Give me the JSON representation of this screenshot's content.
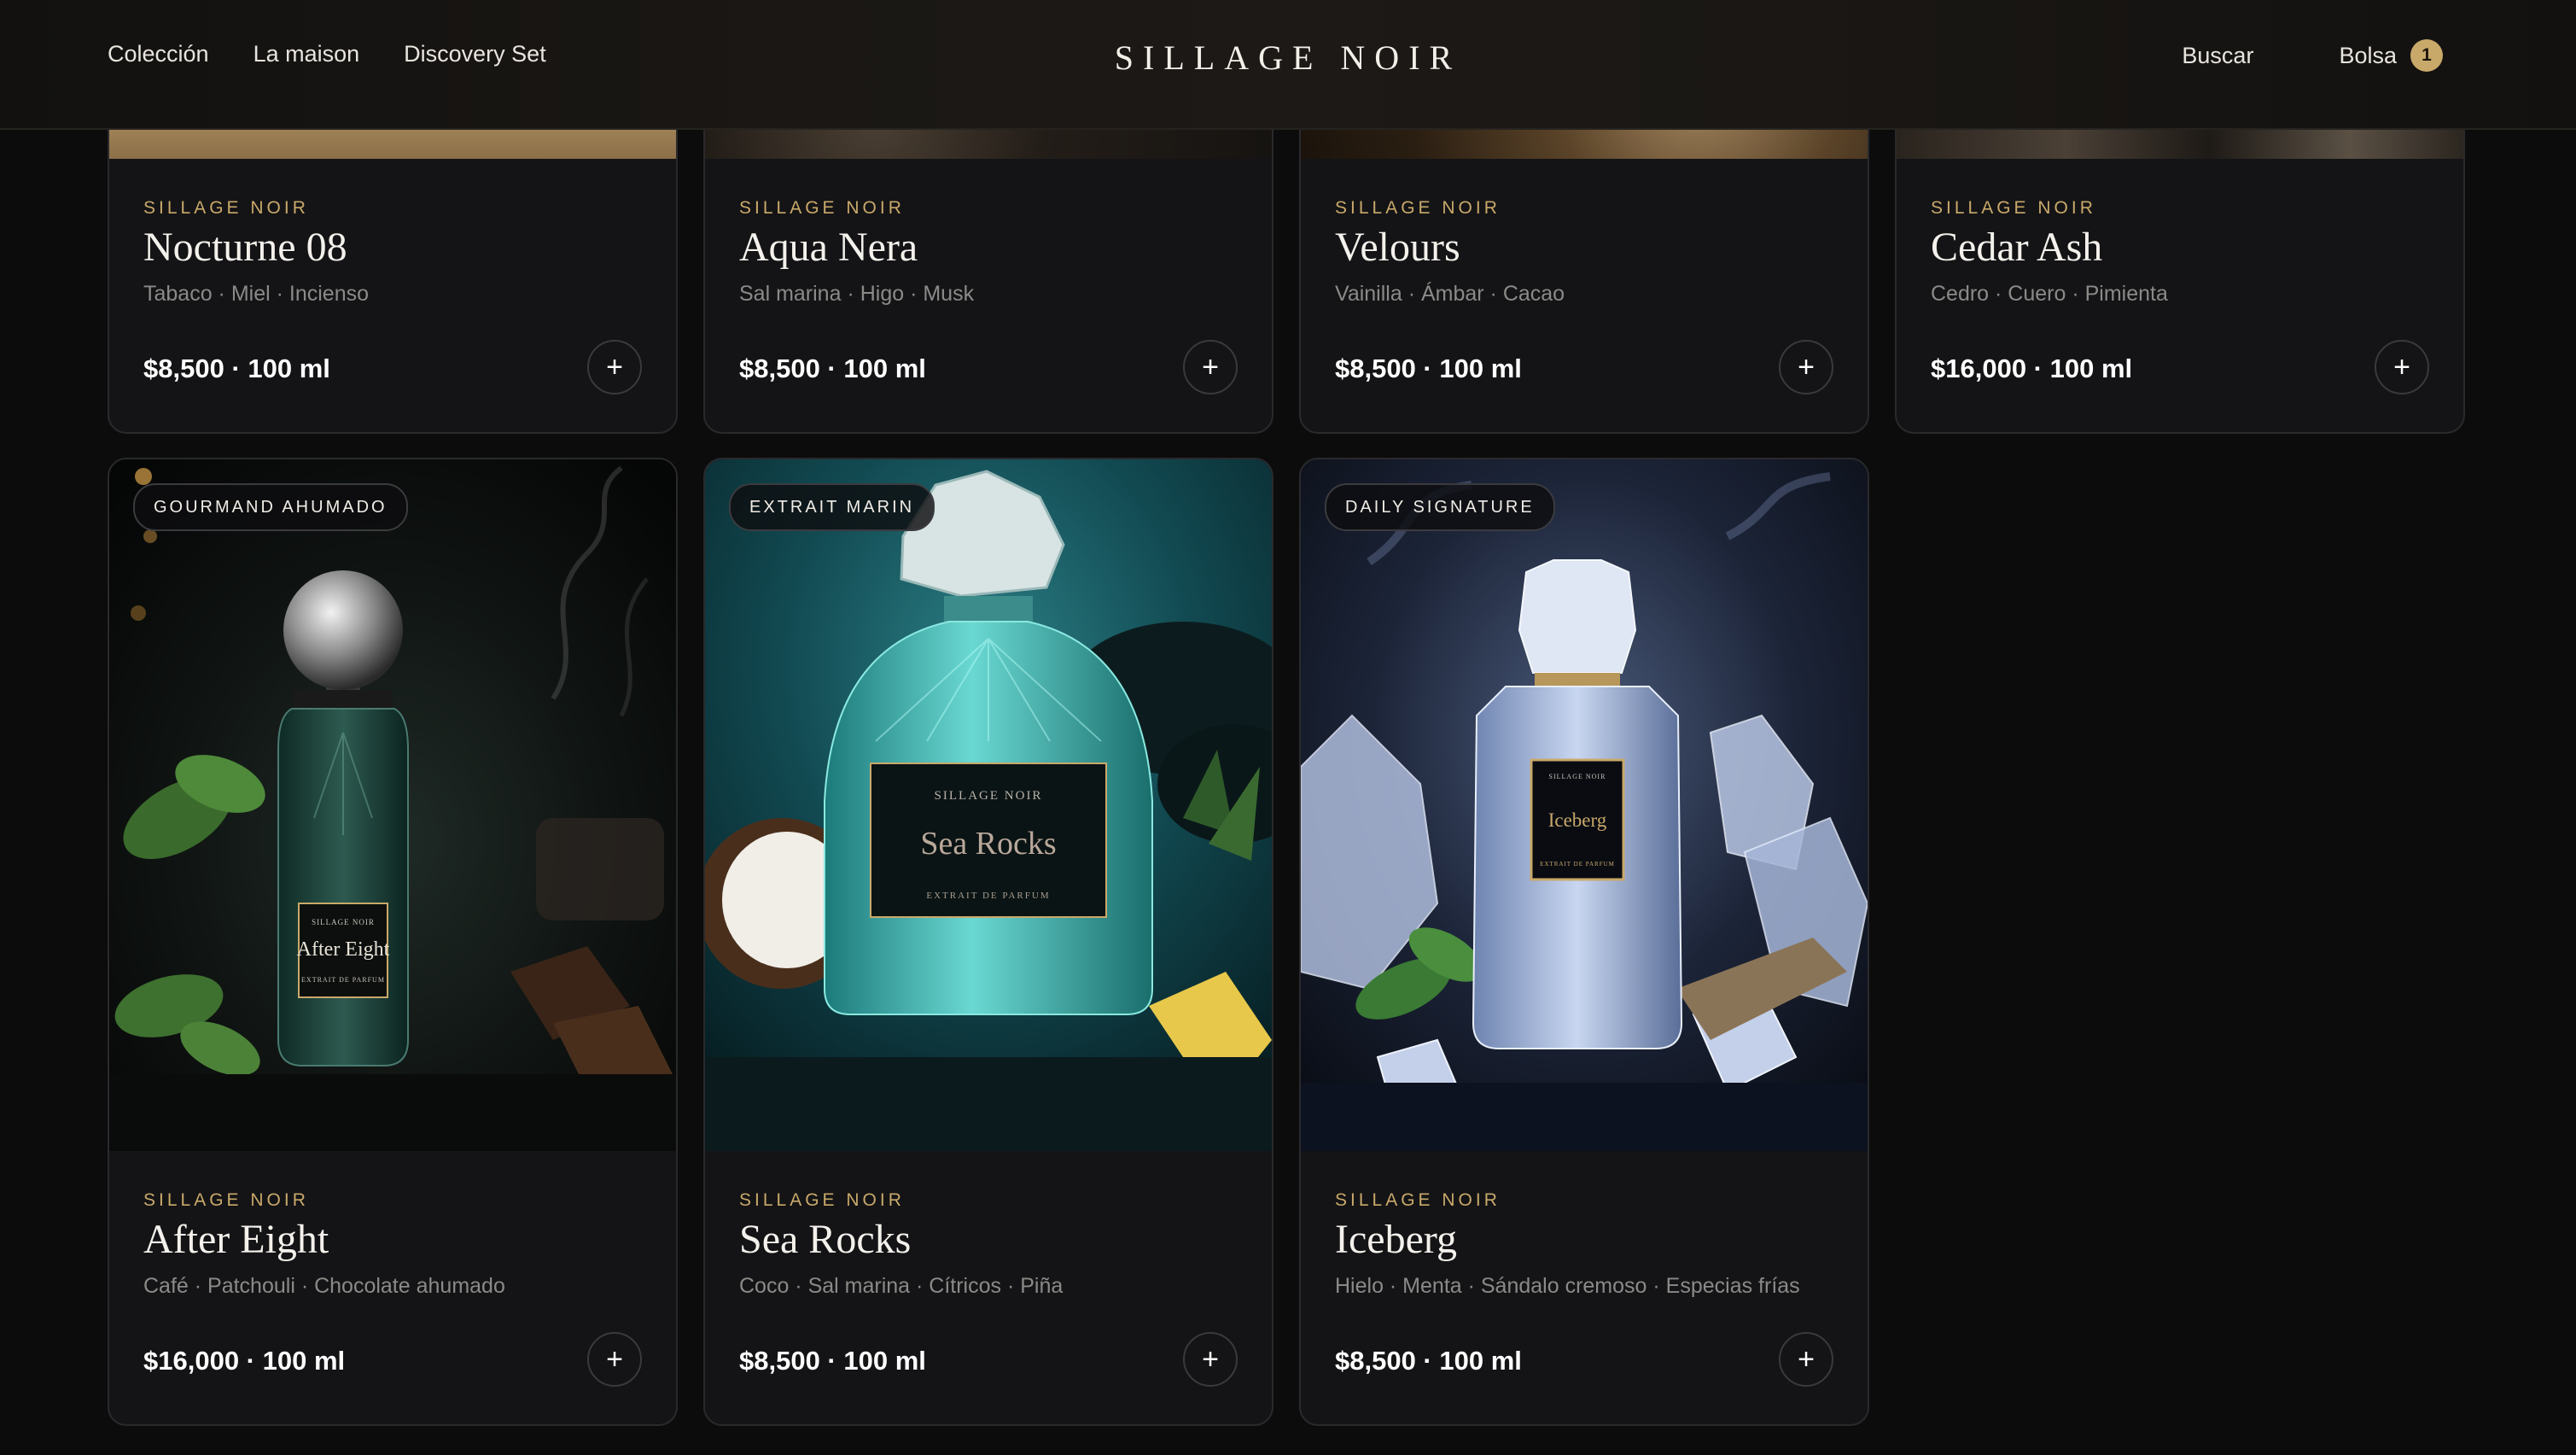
{
  "header": {
    "nav": [
      "Colección",
      "La maison",
      "Discovery Set"
    ],
    "brand": "SILLAGE NOIR",
    "search": "Buscar",
    "bag_label": "Bolsa",
    "bag_count": "1"
  },
  "colors": {
    "accent": "#c9a96a",
    "background": "#0c0c0d",
    "card": "#141416"
  },
  "products": [
    {
      "brand": "SILLAGE NOIR",
      "name": "Nocturne 08",
      "notes": "Tabaco · Miel · Incienso",
      "price": "$8,500 · 100 ml"
    },
    {
      "brand": "SILLAGE NOIR",
      "name": "Aqua Nera",
      "notes": "Sal marina · Higo · Musk",
      "price": "$8,500 · 100 ml"
    },
    {
      "brand": "SILLAGE NOIR",
      "name": "Velours",
      "notes": "Vainilla · Ámbar · Cacao",
      "price": "$8,500 · 100 ml"
    },
    {
      "brand": "SILLAGE NOIR",
      "name": "Cedar Ash",
      "notes": "Cedro · Cuero · Pimienta",
      "price": "$16,000 · 100 ml"
    },
    {
      "brand": "SILLAGE NOIR",
      "name": "After Eight",
      "notes": "Café · Patchouli · Chocolate ahumado",
      "price": "$16,000 · 100 ml",
      "tag": "GOURMAND AHUMADO",
      "bottle": {
        "brand": "SILLAGE NOIR",
        "name": "After Eight",
        "sub": "EXTRAIT DE PARFUM"
      }
    },
    {
      "brand": "SILLAGE NOIR",
      "name": "Sea Rocks",
      "notes": "Coco · Sal marina · Cítricos · Piña",
      "price": "$8,500 · 100 ml",
      "tag": "EXTRAIT MARIN",
      "bottle": {
        "brand": "SILLAGE NOIR",
        "name": "Sea Rocks",
        "sub": "EXTRAIT DE PARFUM"
      }
    },
    {
      "brand": "SILLAGE NOIR",
      "name": "Iceberg",
      "notes": "Hielo · Menta · Sándalo cremoso · Especias frías",
      "price": "$8,500 · 100 ml",
      "tag": "DAILY SIGNATURE",
      "bottle": {
        "brand": "SILLAGE NOIR",
        "name": "Iceberg",
        "sub": "EXTRAIT DE PARFUM"
      }
    }
  ],
  "icons": {
    "add": "plus-icon"
  },
  "add_symbol": "+"
}
